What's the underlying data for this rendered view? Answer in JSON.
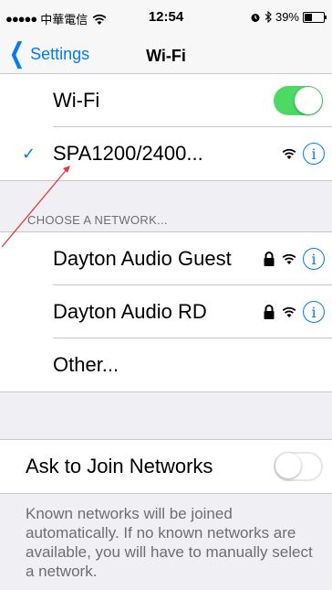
{
  "status": {
    "signal": "●●●●●",
    "carrier": "中華電信",
    "time": "12:54",
    "battery_text": "39%",
    "battery_level": 0.39
  },
  "nav": {
    "back_label": "Settings",
    "title": "Wi-Fi"
  },
  "wifi_row": {
    "label": "Wi-Fi",
    "enabled": true
  },
  "connected_network": {
    "name": "SPA1200/2400...",
    "check": "✓"
  },
  "choose_header": "CHOOSE A NETWORK...",
  "networks": [
    {
      "name": "Dayton Audio Guest",
      "locked": true
    },
    {
      "name": "Dayton Audio RD",
      "locked": true
    },
    {
      "name": "Other...",
      "locked": false
    }
  ],
  "ask_to_join": {
    "label": "Ask to Join Networks",
    "enabled": false
  },
  "footer": "Known networks will be joined automatically. If no known networks are available, you will have to manually select a network.",
  "colors": {
    "accent": "#007aff",
    "toggle_on": "#4cd964",
    "annotation": "#e53935"
  },
  "icons": {
    "wifi": "wifi-icon",
    "lock": "lock-icon",
    "info": "info-icon",
    "alarm": "alarm-icon",
    "bluetooth": "bluetooth-icon"
  }
}
